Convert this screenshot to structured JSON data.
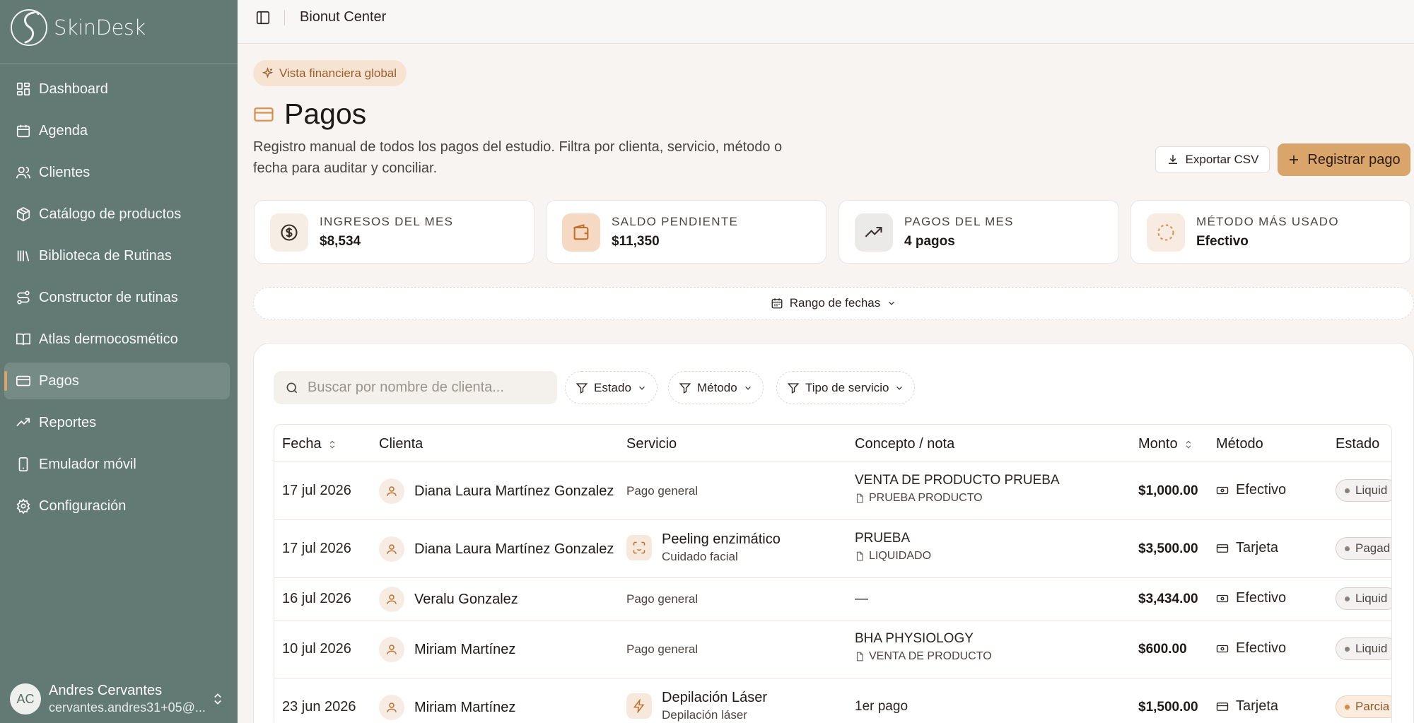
{
  "sidebar": {
    "logo_text": "SkinDesk",
    "items": [
      {
        "label": "Dashboard",
        "icon": "dashboard-icon"
      },
      {
        "label": "Agenda",
        "icon": "calendar-icon"
      },
      {
        "label": "Clientes",
        "icon": "users-icon"
      },
      {
        "label": "Catálogo de productos",
        "icon": "package-icon"
      },
      {
        "label": "Biblioteca de Rutinas",
        "icon": "library-icon"
      },
      {
        "label": "Constructor de rutinas",
        "icon": "route-icon"
      },
      {
        "label": "Atlas dermocosmético",
        "icon": "book-icon"
      },
      {
        "label": "Pagos",
        "icon": "credit-card-icon",
        "active": true
      },
      {
        "label": "Reportes",
        "icon": "trending-up-icon"
      },
      {
        "label": "Emulador móvil",
        "icon": "smartphone-icon"
      },
      {
        "label": "Configuración",
        "icon": "gear-icon"
      }
    ],
    "user": {
      "initials": "AC",
      "name": "Andres Cervantes",
      "email": "cervantes.andres31+05@..."
    }
  },
  "topbar": {
    "breadcrumb": "Bionut Center"
  },
  "header": {
    "pill": "Vista financiera global",
    "title": "Pagos",
    "subtitle": "Registro manual de todos los pagos del estudio. Filtra por clienta, servicio, método o fecha para auditar y conciliar.",
    "export_label": "Exportar CSV",
    "register_label": "Registrar pago"
  },
  "stats": [
    {
      "label": "INGRESOS DEL MES",
      "value": "$8,534",
      "icon": "dollar-circle-icon"
    },
    {
      "label": "SALDO PENDIENTE",
      "value": "$11,350",
      "icon": "wallet-icon"
    },
    {
      "label": "PAGOS DEL MES",
      "value": "4 pagos",
      "icon": "trending-up-icon"
    },
    {
      "label": "MÉTODO MÁS USADO",
      "value": "Efectivo",
      "icon": "dashed-circle-icon"
    }
  ],
  "date_range": {
    "label": "Rango de fechas"
  },
  "filters": {
    "search_placeholder": "Buscar por nombre de clienta...",
    "estado": "Estado",
    "metodo": "Método",
    "tipo": "Tipo de servicio"
  },
  "table": {
    "columns": [
      "Fecha",
      "Clienta",
      "Servicio",
      "Concepto / nota",
      "Monto",
      "Método",
      "Estado"
    ],
    "rows": [
      {
        "fecha": "17 jul 2026",
        "clienta": "Diana Laura Martínez Gonzalez",
        "servicio": "Pago general",
        "servicio_sub": "",
        "concepto": "VENTA DE PRODUCTO PRUEBA",
        "nota": "PRUEBA PRODUCTO",
        "monto": "$1,000.00",
        "metodo": "Efectivo",
        "estado": "Liquid"
      },
      {
        "fecha": "17 jul 2026",
        "clienta": "Diana Laura Martínez Gonzalez",
        "servicio": "Peeling enzimático",
        "servicio_sub": "Cuidado facial",
        "concepto": "PRUEBA",
        "nota": "LIQUIDADO",
        "monto": "$3,500.00",
        "metodo": "Tarjeta",
        "estado": "Pagad"
      },
      {
        "fecha": "16 jul 2026",
        "clienta": "Veralu Gonzalez",
        "servicio": "Pago general",
        "servicio_sub": "",
        "concepto": "—",
        "nota": "",
        "monto": "$3,434.00",
        "metodo": "Efectivo",
        "estado": "Liquid"
      },
      {
        "fecha": "10 jul 2026",
        "clienta": "Miriam Martínez",
        "servicio": "Pago general",
        "servicio_sub": "",
        "concepto": "BHA PHYSIOLOGY",
        "nota": "VENTA DE PRODUCTO",
        "monto": "$600.00",
        "metodo": "Efectivo",
        "estado": "Liquid"
      },
      {
        "fecha": "23 jun 2026",
        "clienta": "Miriam Martínez",
        "servicio": "Depilación Láser",
        "servicio_sub": "Depilación láser",
        "concepto": "1er pago",
        "nota": "",
        "monto": "$1,500.00",
        "metodo": "Tarjeta",
        "estado": "Parcia"
      }
    ]
  }
}
